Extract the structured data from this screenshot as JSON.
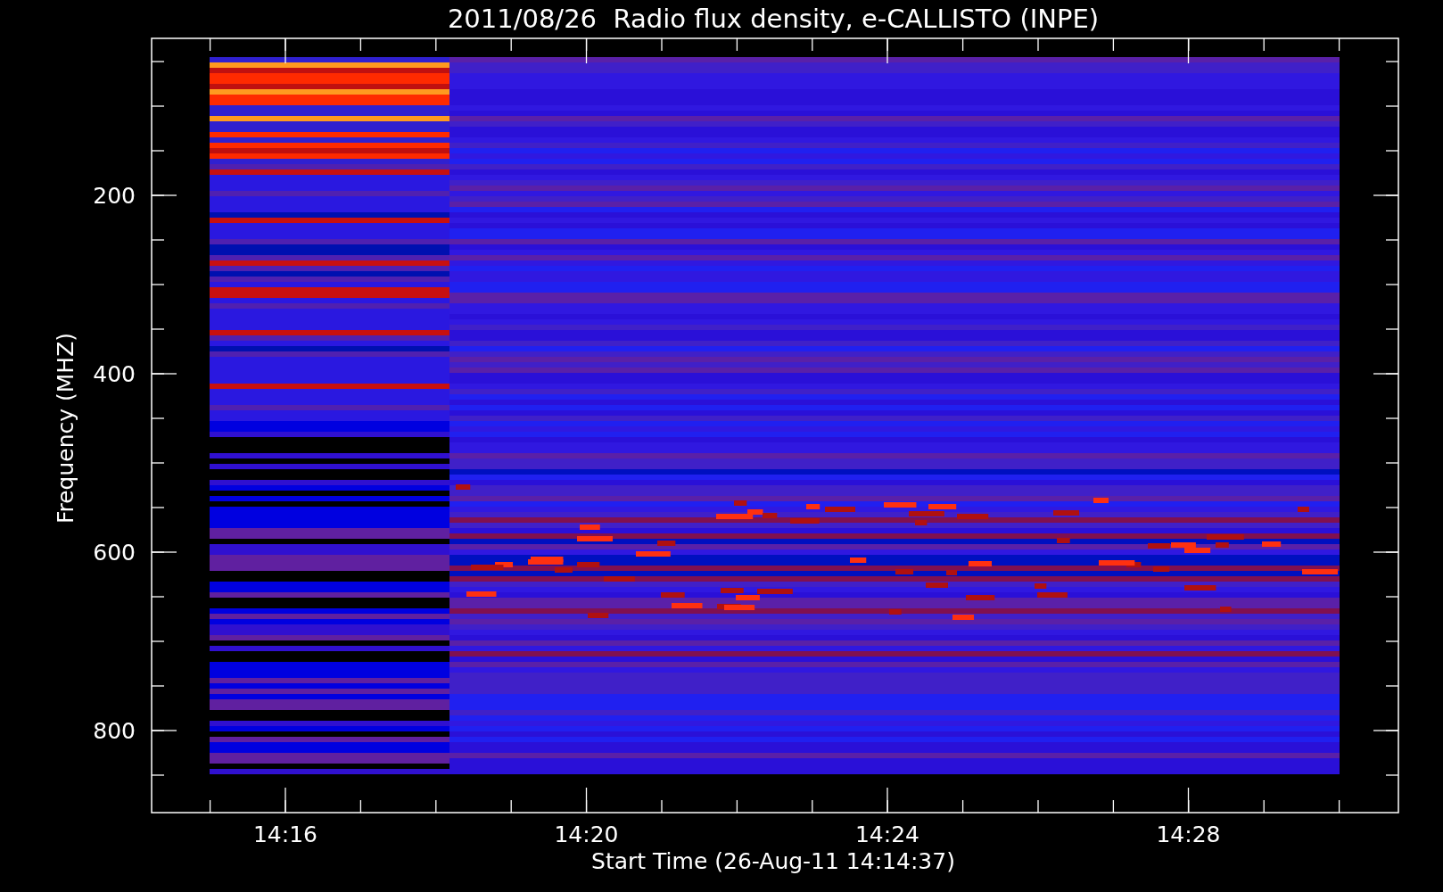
{
  "plot": {
    "title": "2011/08/26  Radio flux density, e-CALLISTO (INPE)",
    "xlabel": "Start Time (26-Aug-11 14:14:37)",
    "ylabel": "Frequency (MHZ)",
    "xticks": [
      "14:16",
      "14:20",
      "14:24",
      "14:28"
    ],
    "yticks": [
      "200",
      "400",
      "600",
      "800"
    ]
  }
}
